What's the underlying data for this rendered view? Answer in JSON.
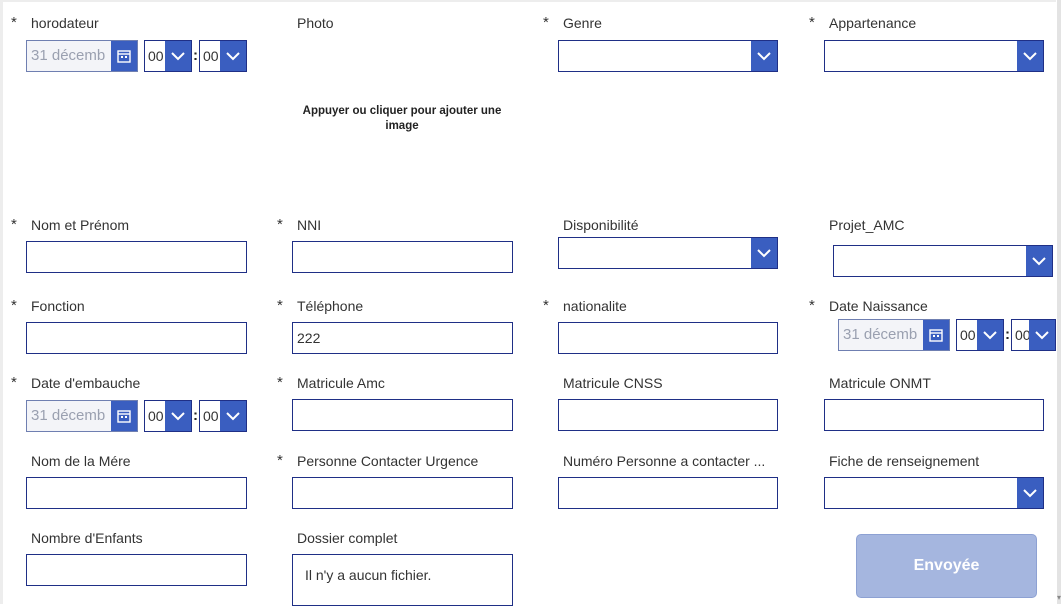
{
  "form": {
    "required_mark": "*",
    "fields": {
      "horodateur": {
        "label": "horodateur",
        "date_placeholder": "31 décemb",
        "hour": "00",
        "minute": "00"
      },
      "photo": {
        "label": "Photo",
        "hint": "Appuyer ou cliquer pour ajouter une image"
      },
      "genre": {
        "label": "Genre",
        "value": ""
      },
      "appartenance": {
        "label": "Appartenance",
        "value": ""
      },
      "nom_prenom": {
        "label": "Nom et Prénom",
        "value": ""
      },
      "nni": {
        "label": "NNI",
        "value": ""
      },
      "disponibilite": {
        "label": "Disponibilité",
        "value": ""
      },
      "projet_amc": {
        "label": "Projet_AMC",
        "value": ""
      },
      "fonction": {
        "label": "Fonction",
        "value": ""
      },
      "telephone": {
        "label": "Téléphone",
        "value": "222"
      },
      "nationalite": {
        "label": "nationalite",
        "value": ""
      },
      "date_naissance": {
        "label": "Date Naissance",
        "date_placeholder": "31 décemb",
        "hour": "00",
        "minute": "00"
      },
      "date_embauche": {
        "label": "Date d'embauche",
        "date_placeholder": "31 décemb",
        "hour": "00",
        "minute": "00"
      },
      "matricule_amc": {
        "label": "Matricule Amc",
        "value": ""
      },
      "matricule_cnss": {
        "label": "Matricule CNSS",
        "value": ""
      },
      "matricule_onmt": {
        "label": "Matricule ONMT",
        "value": ""
      },
      "nom_mere": {
        "label": "Nom de la Mére",
        "value": ""
      },
      "personne_urgence": {
        "label": "Personne Contacter Urgence",
        "value": ""
      },
      "numero_personne": {
        "label": "Numéro Personne a contacter ...",
        "value": ""
      },
      "fiche_renseignement": {
        "label": "Fiche de renseignement",
        "value": ""
      },
      "nombre_enfants": {
        "label": "Nombre d'Enfants",
        "value": ""
      },
      "dossier_complet": {
        "label": "Dossier complet",
        "value": "Il n'y a aucun fichier."
      }
    },
    "submit_label": "Envoyée"
  },
  "icons": {
    "dropdown": "chevron-down-icon",
    "calendar": "calendar-icon"
  },
  "colors": {
    "accent": "#3a5ec0",
    "border": "#1f2f86",
    "submit_disabled": "#a5b6df"
  }
}
